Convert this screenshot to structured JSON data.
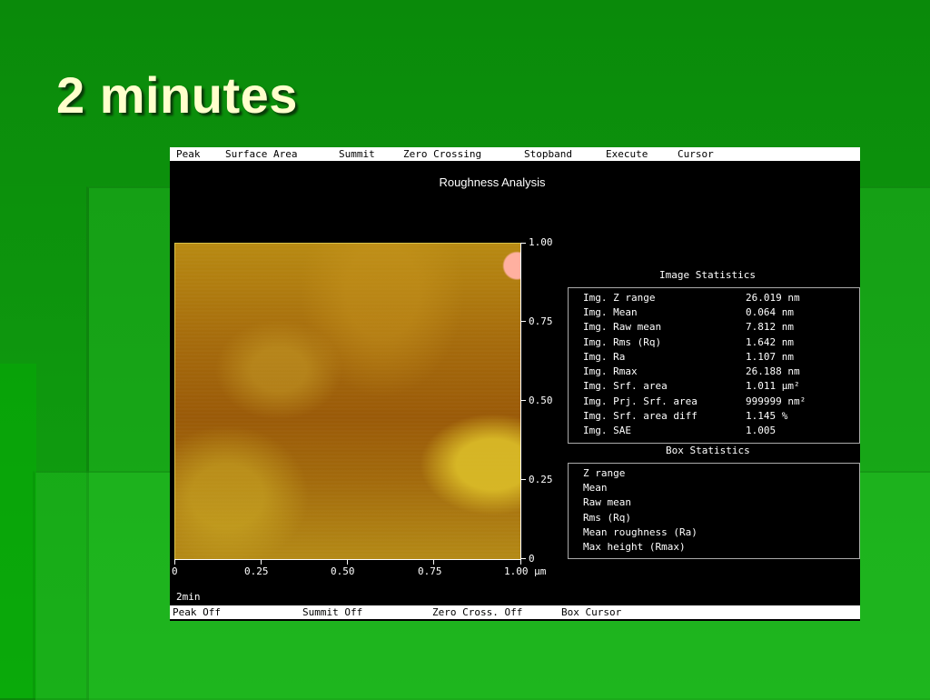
{
  "slide": {
    "title": "2 minutes"
  },
  "menubar": [
    "Peak",
    "Surface Area",
    "Summit",
    "Zero Crossing",
    "Stopband",
    "Execute",
    "Cursor"
  ],
  "window": {
    "title": "Roughness Analysis",
    "image_label": "2min"
  },
  "axes": {
    "y_ticks": [
      "1.00",
      "0.75",
      "0.50",
      "0.25",
      "0"
    ],
    "x_ticks": [
      "0",
      "0.25",
      "0.50",
      "0.75",
      "1.00 µm"
    ]
  },
  "image_stats": {
    "title": "Image Statistics",
    "rows": [
      {
        "label": "Img. Z range",
        "value": "26.019 nm"
      },
      {
        "label": "Img. Mean",
        "value": "0.064 nm"
      },
      {
        "label": "Img. Raw mean",
        "value": "7.812 nm"
      },
      {
        "label": "Img. Rms (Rq)",
        "value": "1.642 nm"
      },
      {
        "label": "Img. Ra",
        "value": "1.107 nm"
      },
      {
        "label": "Img. Rmax",
        "value": "26.188 nm"
      },
      {
        "label": "Img. Srf. area",
        "value": "1.011 µm²"
      },
      {
        "label": "Img. Prj. Srf. area",
        "value": "999999 nm²"
      },
      {
        "label": "Img. Srf. area diff",
        "value": "1.145 %"
      },
      {
        "label": "Img. SAE",
        "value": "1.005"
      }
    ]
  },
  "box_stats": {
    "title": "Box Statistics",
    "rows": [
      "Z range",
      "Mean",
      "Raw mean",
      "Rms (Rq)",
      "Mean roughness (Ra)",
      "Max height (Rmax)"
    ]
  },
  "statusbar": [
    "Peak Off",
    "Summit Off",
    "Zero Cross. Off",
    "Box Cursor"
  ]
}
